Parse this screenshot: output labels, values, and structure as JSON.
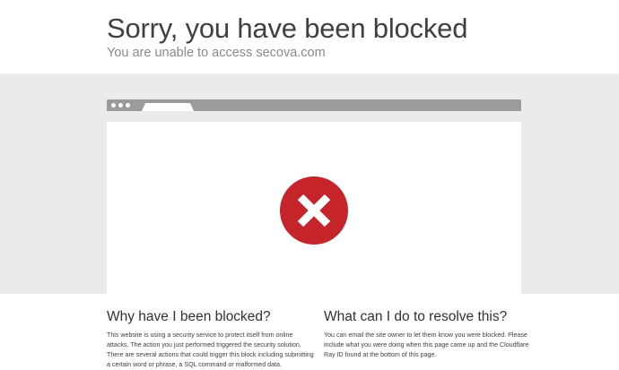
{
  "header": {
    "title": "Sorry, you have been blocked",
    "subtitle": "You are unable to access secova.com"
  },
  "browser_illustration": {
    "icon": "error-x-icon",
    "colors": {
      "icon_circle": "#c4242a",
      "browser_bar": "#9b9b9b",
      "band": "#ebebeb"
    }
  },
  "sections": {
    "why": {
      "heading": "Why have I been blocked?",
      "body": "This website is using a security service to protect itself from online attacks. The action you just performed triggered the security solution. There are several actions that could trigger this block including submitting a certain word or phrase, a SQL command or malformed data."
    },
    "resolve": {
      "heading": "What can I do to resolve this?",
      "body": "You can email the site owner to let them know you were blocked. Please include what you were doing when this page came up and the Cloudflare Ray ID found at the bottom of this page."
    }
  }
}
